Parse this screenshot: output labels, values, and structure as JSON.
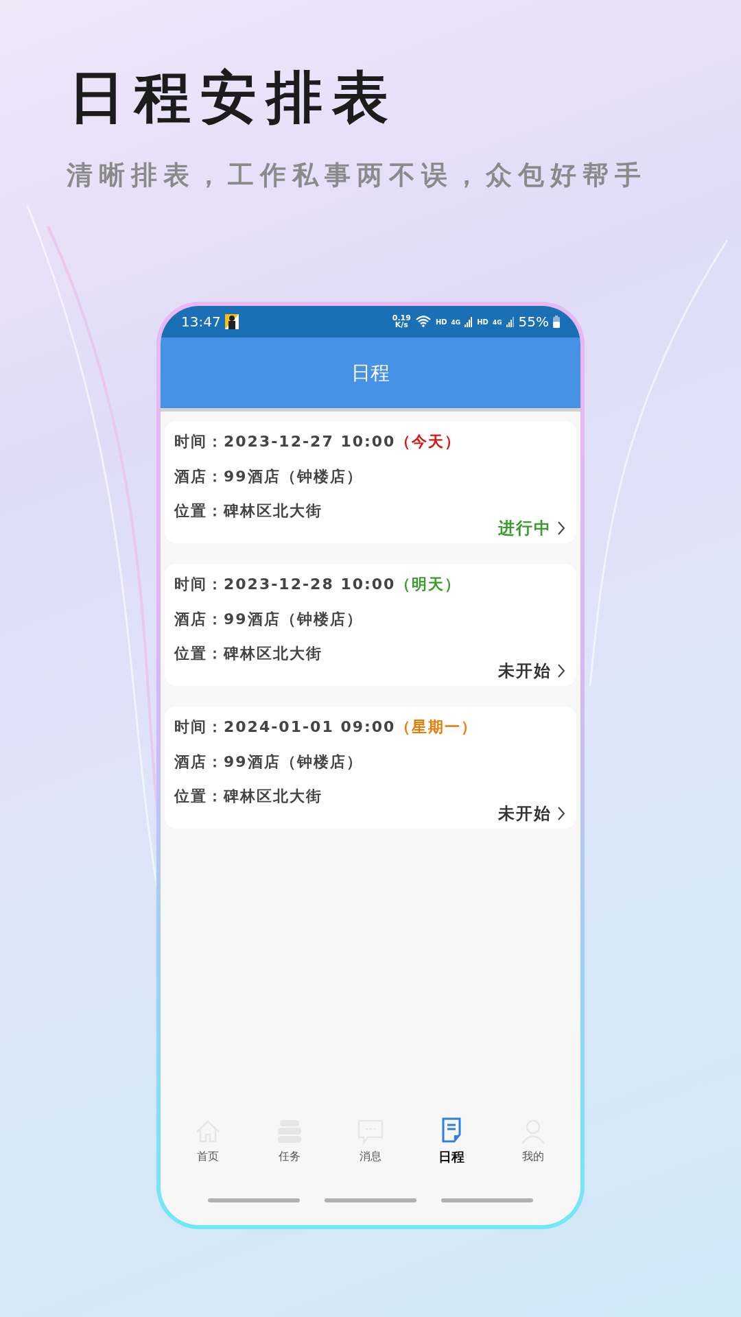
{
  "headline": "日程安排表",
  "subtitle": "清晰排表，工作私事两不误，众包好帮手",
  "status_bar": {
    "time": "13:47",
    "speed_value": "0.19",
    "speed_unit": "K/s",
    "network_1": "HD",
    "signal_1": "4G",
    "network_2": "HD",
    "signal_2": "4G",
    "battery": "55%"
  },
  "header": {
    "title": "日程"
  },
  "schedules": [
    {
      "time_label": "时间：",
      "time": "2023-12-27 10:00",
      "day_tag": {
        "text": "（今天）",
        "color": "#e01010"
      },
      "hotel_label": "酒店：",
      "hotel": "99酒店（钟楼店）",
      "location_label": "位置：",
      "location": "碑林区北大街",
      "status": {
        "text": "进行中",
        "color": "#3a9a2a"
      }
    },
    {
      "time_label": "时间：",
      "time": "2023-12-28 10:00",
      "day_tag": {
        "text": "（明天）",
        "color": "#3a9a2a"
      },
      "hotel_label": "酒店：",
      "hotel": "99酒店（钟楼店）",
      "location_label": "位置：",
      "location": "碑林区北大街",
      "status": {
        "text": "未开始",
        "color": "#333333"
      }
    },
    {
      "time_label": "时间：",
      "time": "2024-01-01 09:00",
      "day_tag": {
        "text": "（星期一）",
        "color": "#f07800"
      },
      "hotel_label": "酒店：",
      "hotel": "99酒店（钟楼店）",
      "location_label": "位置：",
      "location": "碑林区北大街",
      "status": {
        "text": "未开始",
        "color": "#333333"
      }
    }
  ],
  "tabs": [
    {
      "label": "首页",
      "kind": "home",
      "selected": false
    },
    {
      "label": "任务",
      "kind": "tasks",
      "selected": false
    },
    {
      "label": "消息",
      "kind": "messages",
      "selected": false
    },
    {
      "label": "日程",
      "kind": "schedule",
      "selected": true
    },
    {
      "label": "我的",
      "kind": "profile",
      "selected": false
    }
  ]
}
